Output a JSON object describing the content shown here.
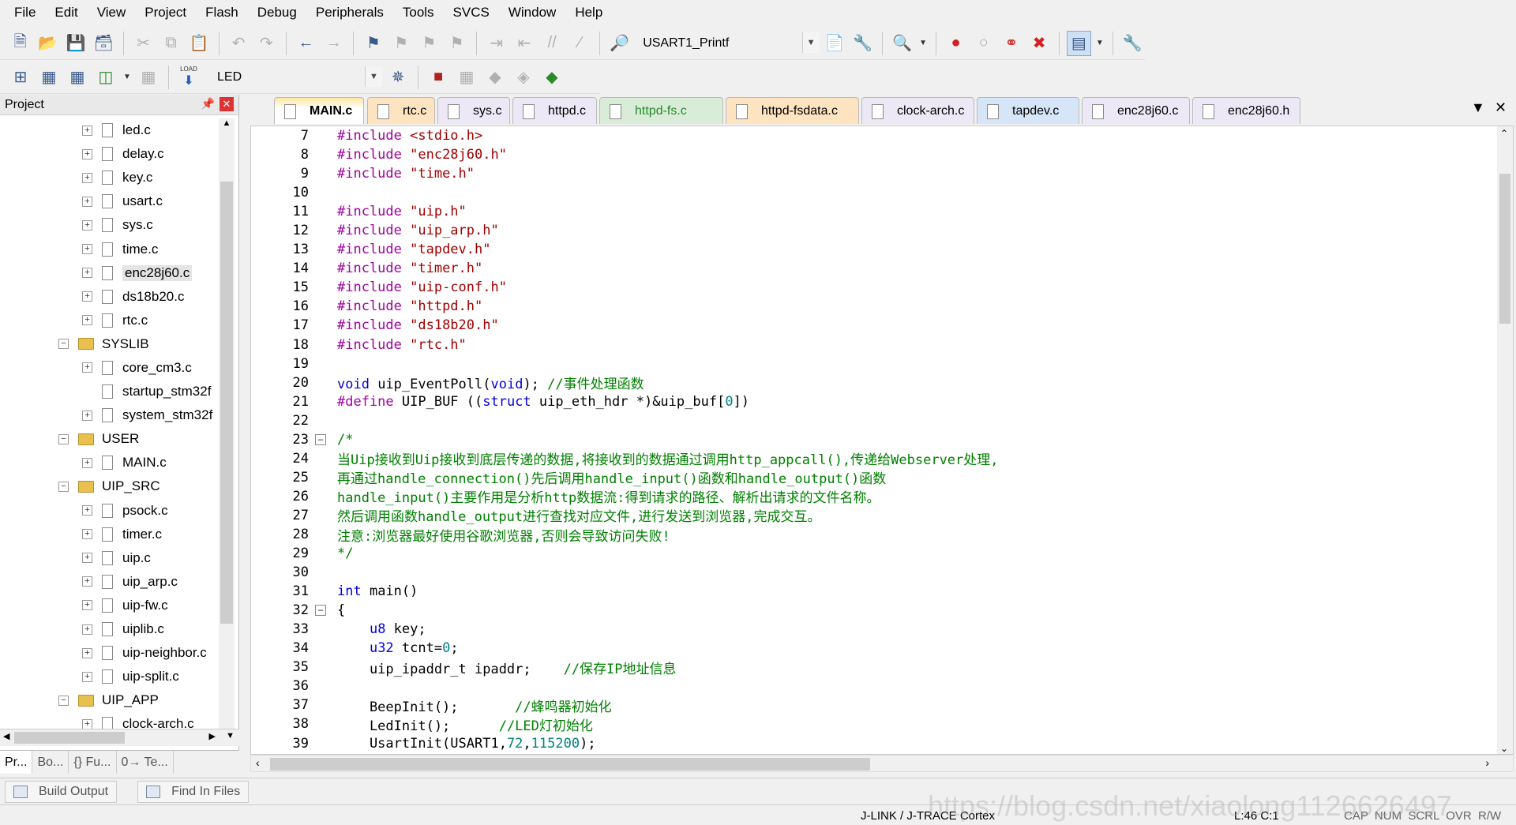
{
  "menu": [
    "File",
    "Edit",
    "View",
    "Project",
    "Flash",
    "Debug",
    "Peripherals",
    "Tools",
    "SVCS",
    "Window",
    "Help"
  ],
  "toolbar": {
    "function_combo": "USART1_Printf",
    "target_combo": "LED",
    "load_label": "LOAD"
  },
  "project": {
    "title": "Project",
    "tree": [
      {
        "type": "file",
        "label": "led.c",
        "expandable": true
      },
      {
        "type": "file",
        "label": "delay.c",
        "expandable": true
      },
      {
        "type": "file",
        "label": "key.c",
        "expandable": true
      },
      {
        "type": "file",
        "label": "usart.c",
        "expandable": true
      },
      {
        "type": "file",
        "label": "sys.c",
        "expandable": true
      },
      {
        "type": "file",
        "label": "time.c",
        "expandable": true
      },
      {
        "type": "file",
        "label": "enc28j60.c",
        "expandable": true,
        "selected": true
      },
      {
        "type": "file",
        "label": "ds18b20.c",
        "expandable": true
      },
      {
        "type": "file",
        "label": "rtc.c",
        "expandable": true
      },
      {
        "type": "folder",
        "label": "SYSLIB"
      },
      {
        "type": "file",
        "label": "core_cm3.c",
        "expandable": true
      },
      {
        "type": "file",
        "label": "startup_stm32f",
        "expandable": false
      },
      {
        "type": "file",
        "label": "system_stm32f",
        "expandable": true
      },
      {
        "type": "folder",
        "label": "USER"
      },
      {
        "type": "file",
        "label": "MAIN.c",
        "expandable": true
      },
      {
        "type": "folder",
        "label": "UIP_SRC"
      },
      {
        "type": "file",
        "label": "psock.c",
        "expandable": true
      },
      {
        "type": "file",
        "label": "timer.c",
        "expandable": true
      },
      {
        "type": "file",
        "label": "uip.c",
        "expandable": true
      },
      {
        "type": "file",
        "label": "uip_arp.c",
        "expandable": true
      },
      {
        "type": "file",
        "label": "uip-fw.c",
        "expandable": true
      },
      {
        "type": "file",
        "label": "uiplib.c",
        "expandable": true
      },
      {
        "type": "file",
        "label": "uip-neighbor.c",
        "expandable": true
      },
      {
        "type": "file",
        "label": "uip-split.c",
        "expandable": true
      },
      {
        "type": "folder",
        "label": "UIP_APP"
      },
      {
        "type": "file",
        "label": "clock-arch.c",
        "expandable": true
      }
    ],
    "bottom_tabs": [
      "Pr...",
      "Bo...",
      "{} Fu...",
      "0→ Te..."
    ]
  },
  "tabs": [
    {
      "label": "MAIN.c",
      "active": true,
      "style": "active"
    },
    {
      "label": "rtc.c",
      "style": "orange"
    },
    {
      "label": "sys.c",
      "style": "plain"
    },
    {
      "label": "httpd.c",
      "style": "plain"
    },
    {
      "label": "httpd-fs.c",
      "style": "green"
    },
    {
      "label": "httpd-fsdata.c",
      "style": "orange"
    },
    {
      "label": "clock-arch.c",
      "style": "plain"
    },
    {
      "label": "tapdev.c",
      "style": "blue"
    },
    {
      "label": "enc28j60.c",
      "style": "plain"
    },
    {
      "label": "enc28j60.h",
      "style": "plain"
    }
  ],
  "code": [
    {
      "n": "7",
      "fold": "",
      "parts": [
        [
          "pp",
          "#include "
        ],
        [
          "str",
          "<stdio.h>"
        ]
      ]
    },
    {
      "n": "8",
      "fold": "",
      "parts": [
        [
          "pp",
          "#include "
        ],
        [
          "str",
          "\"enc28j60.h\""
        ]
      ]
    },
    {
      "n": "9",
      "fold": "",
      "parts": [
        [
          "pp",
          "#include "
        ],
        [
          "str",
          "\"time.h\""
        ]
      ]
    },
    {
      "n": "10",
      "fold": "",
      "parts": []
    },
    {
      "n": "11",
      "fold": "",
      "parts": [
        [
          "pp",
          "#include "
        ],
        [
          "str",
          "\"uip.h\""
        ]
      ]
    },
    {
      "n": "12",
      "fold": "",
      "parts": [
        [
          "pp",
          "#include "
        ],
        [
          "str",
          "\"uip_arp.h\""
        ]
      ]
    },
    {
      "n": "13",
      "fold": "",
      "parts": [
        [
          "pp",
          "#include "
        ],
        [
          "str",
          "\"tapdev.h\""
        ]
      ]
    },
    {
      "n": "14",
      "fold": "",
      "parts": [
        [
          "pp",
          "#include "
        ],
        [
          "str",
          "\"timer.h\""
        ]
      ]
    },
    {
      "n": "15",
      "fold": "",
      "parts": [
        [
          "pp",
          "#include "
        ],
        [
          "str",
          "\"uip-conf.h\""
        ]
      ]
    },
    {
      "n": "16",
      "fold": "",
      "parts": [
        [
          "pp",
          "#include "
        ],
        [
          "str",
          "\"httpd.h\""
        ]
      ]
    },
    {
      "n": "17",
      "fold": "",
      "parts": [
        [
          "pp",
          "#include "
        ],
        [
          "str",
          "\"ds18b20.h\""
        ]
      ]
    },
    {
      "n": "18",
      "fold": "",
      "parts": [
        [
          "pp",
          "#include "
        ],
        [
          "str",
          "\"rtc.h\""
        ]
      ]
    },
    {
      "n": "19",
      "fold": "",
      "parts": []
    },
    {
      "n": "20",
      "fold": "",
      "parts": [
        [
          "kw",
          "void"
        ],
        [
          "plain",
          " uip_EventPoll("
        ],
        [
          "kw",
          "void"
        ],
        [
          "plain",
          "); "
        ],
        [
          "cm",
          "//事件处理函数"
        ]
      ]
    },
    {
      "n": "21",
      "fold": "",
      "parts": [
        [
          "pp",
          "#define"
        ],
        [
          "plain",
          " UIP_BUF (("
        ],
        [
          "kw",
          "struct"
        ],
        [
          "plain",
          " uip_eth_hdr *)&uip_buf["
        ],
        [
          "num",
          "0"
        ],
        [
          "plain",
          "])"
        ]
      ]
    },
    {
      "n": "22",
      "fold": "",
      "parts": []
    },
    {
      "n": "23",
      "fold": "-",
      "parts": [
        [
          "cm",
          "/*"
        ]
      ]
    },
    {
      "n": "24",
      "fold": "",
      "parts": [
        [
          "cm",
          "当Uip接收到Uip接收到底层传递的数据,将接收到的数据通过调用http_appcall(),传递给Webserver处理,"
        ]
      ]
    },
    {
      "n": "25",
      "fold": "",
      "parts": [
        [
          "cm",
          "再通过handle_connection()先后调用handle_input()函数和handle_output()函数"
        ]
      ]
    },
    {
      "n": "26",
      "fold": "",
      "parts": [
        [
          "cm",
          "handle_input()主要作用是分析http数据流:得到请求的路径、解析出请求的文件名称。"
        ]
      ]
    },
    {
      "n": "27",
      "fold": "",
      "parts": [
        [
          "cm",
          "然后调用函数handle_output进行查找对应文件,进行发送到浏览器,完成交互。"
        ]
      ]
    },
    {
      "n": "28",
      "fold": "",
      "parts": [
        [
          "cm",
          "注意:浏览器最好使用谷歌浏览器,否则会导致访问失败!"
        ]
      ]
    },
    {
      "n": "29",
      "fold": "",
      "parts": [
        [
          "cm",
          "*/"
        ]
      ]
    },
    {
      "n": "30",
      "fold": "",
      "parts": []
    },
    {
      "n": "31",
      "fold": "",
      "parts": [
        [
          "kw",
          "int"
        ],
        [
          "plain",
          " main()"
        ]
      ]
    },
    {
      "n": "32",
      "fold": "-",
      "parts": [
        [
          "plain",
          "{"
        ]
      ]
    },
    {
      "n": "33",
      "fold": "",
      "parts": [
        [
          "plain",
          "    "
        ],
        [
          "kw",
          "u8"
        ],
        [
          "plain",
          " key;"
        ]
      ]
    },
    {
      "n": "34",
      "fold": "",
      "parts": [
        [
          "plain",
          "    "
        ],
        [
          "kw",
          "u32"
        ],
        [
          "plain",
          " tcnt="
        ],
        [
          "num",
          "0"
        ],
        [
          "plain",
          ";"
        ]
      ]
    },
    {
      "n": "35",
      "fold": "",
      "parts": [
        [
          "plain",
          "    uip_ipaddr_t ipaddr;    "
        ],
        [
          "cm",
          "//保存IP地址信息"
        ]
      ]
    },
    {
      "n": "36",
      "fold": "",
      "parts": []
    },
    {
      "n": "37",
      "fold": "",
      "parts": [
        [
          "plain",
          "    BeepInit();       "
        ],
        [
          "cm",
          "//蜂鸣器初始化"
        ]
      ]
    },
    {
      "n": "38",
      "fold": "",
      "parts": [
        [
          "plain",
          "    LedInit();      "
        ],
        [
          "cm",
          "//LED灯初始化"
        ]
      ]
    },
    {
      "n": "39",
      "fold": "",
      "parts": [
        [
          "plain",
          "    UsartInit(USART1,"
        ],
        [
          "num",
          "72"
        ],
        [
          "plain",
          ","
        ],
        [
          "num",
          "115200"
        ],
        [
          "plain",
          ");"
        ]
      ]
    }
  ],
  "output_tabs": [
    "Build Output",
    "Find In Files"
  ],
  "status": {
    "debugger": "J-LINK / J-TRACE Cortex",
    "position": "L:46 C:1",
    "flags": "CAP  NUM  SCRL  OVR  R/W"
  },
  "watermark": "https://blog.csdn.net/xiaolong1126626497"
}
